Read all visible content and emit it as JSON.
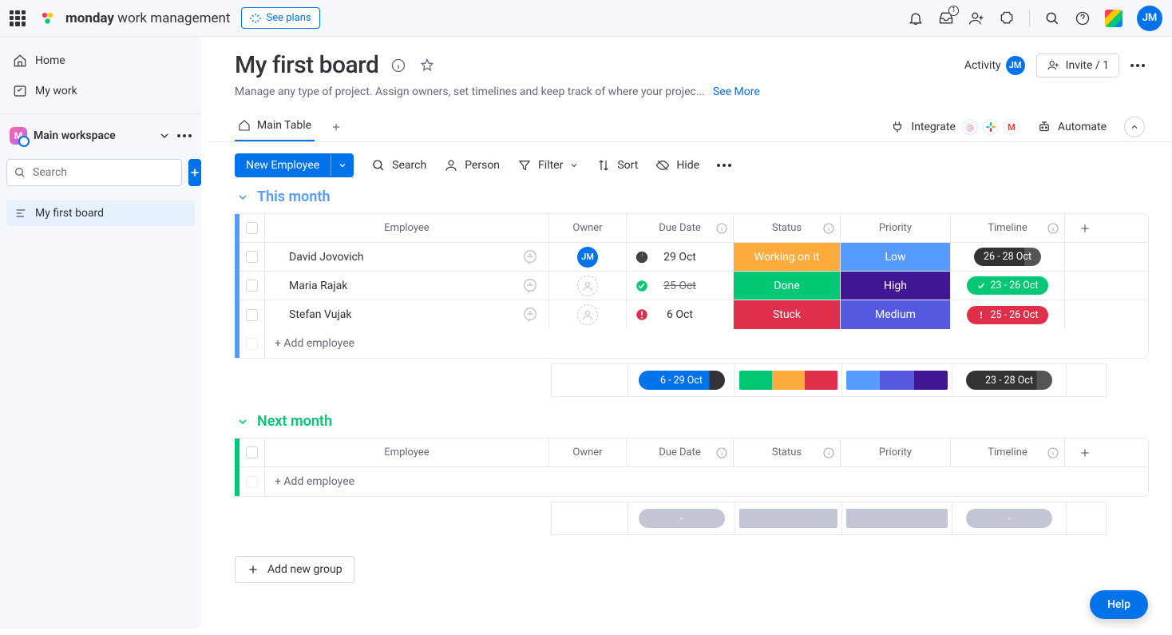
{
  "top": {
    "brand_bold": "monday",
    "brand_rest": " work management",
    "see_plans": "See plans",
    "inbox_badge": "1",
    "avatar": "JM"
  },
  "sidebar": {
    "home": "Home",
    "mywork": "My work",
    "workspace": "Main workspace",
    "ws_initial": "M",
    "search_ph": "Search",
    "board": "My first board"
  },
  "board": {
    "title": "My first board",
    "description": "Manage any type of project. Assign owners, set timelines and keep track of where your projec...",
    "see_more": "See More",
    "activity": "Activity",
    "invite": "Invite / 1",
    "tab": "Main Table",
    "integrate": "Integrate",
    "automate": "Automate"
  },
  "toolbar": {
    "new": "New Employee",
    "search": "Search",
    "person": "Person",
    "filter": "Filter",
    "sort": "Sort",
    "hide": "Hide"
  },
  "columns": {
    "employee": "Employee",
    "owner": "Owner",
    "due": "Due Date",
    "status": "Status",
    "priority": "Priority",
    "timeline": "Timeline"
  },
  "groups": {
    "g1": {
      "title": "This month",
      "rows": [
        {
          "name": "David Jovovich",
          "owner": "JM",
          "due": "29 Oct",
          "due_icon": "clock",
          "status": "Working on it",
          "status_cls": "status-woi",
          "prio": "Low",
          "prio_cls": "prio-low",
          "tl": "26 - 28 Oct",
          "tl_cls": "tl-dark"
        },
        {
          "name": "Maria Rajak",
          "owner": "",
          "due": "25 Oct",
          "due_icon": "check",
          "due_strike": true,
          "status": "Done",
          "status_cls": "status-done",
          "prio": "High",
          "prio_cls": "prio-high",
          "tl": "23 - 26 Oct",
          "tl_cls": "tl-green",
          "tl_icon": "check"
        },
        {
          "name": "Stefan Vujak",
          "owner": "",
          "due": "6 Oct",
          "due_icon": "alert",
          "status": "Stuck",
          "status_cls": "status-stuck",
          "prio": "Medium",
          "prio_cls": "prio-med",
          "tl": "25 - 26 Oct",
          "tl_cls": "tl-red",
          "tl_icon": "alert"
        }
      ],
      "add": "+ Add employee",
      "summary": {
        "due": "6 - 29 Oct",
        "tl": "23 - 28 Oct"
      }
    },
    "g2": {
      "title": "Next month",
      "add": "+ Add employee",
      "summary_dash": "-"
    }
  },
  "add_group": "Add new group",
  "help": "Help"
}
